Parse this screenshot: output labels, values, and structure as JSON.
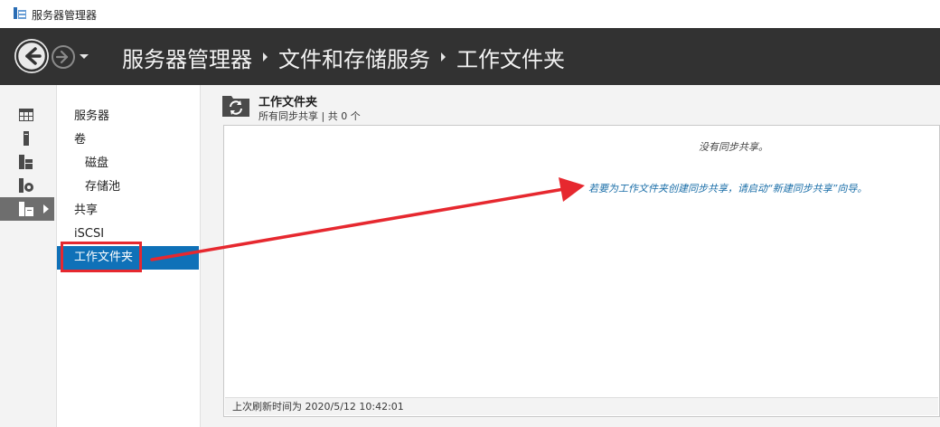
{
  "window": {
    "title": "服务器管理器"
  },
  "breadcrumb": [
    "服务器管理器",
    "文件和存储服务",
    "工作文件夹"
  ],
  "rail": {
    "items": [
      "dashboard-icon",
      "local-server-icon",
      "all-servers-icon",
      "file-server-icon",
      "file-storage-icon"
    ],
    "active_index": 4
  },
  "nav": {
    "items": [
      {
        "label": "服务器",
        "level": 1
      },
      {
        "label": "卷",
        "level": 1
      },
      {
        "label": "磁盘",
        "level": 2
      },
      {
        "label": "存储池",
        "level": 2
      },
      {
        "label": "共享",
        "level": 1
      },
      {
        "label": "iSCSI",
        "level": 1
      },
      {
        "label": "工作文件夹",
        "level": 1
      }
    ],
    "selected_index": 6
  },
  "section": {
    "title": "工作文件夹",
    "subtitle": "所有同步共享 | 共 0 个"
  },
  "panel": {
    "empty_message": "没有同步共享。",
    "wizard_link": "若要为工作文件夹创建同步共享，请启动“新建同步共享”向导。",
    "status": "上次刷新时间为 2020/5/12 10:42:01"
  },
  "colors": {
    "header_bg": "#323232",
    "selected": "#0f71b8",
    "annotation": "#e6282f",
    "link": "#1a6ea8"
  }
}
